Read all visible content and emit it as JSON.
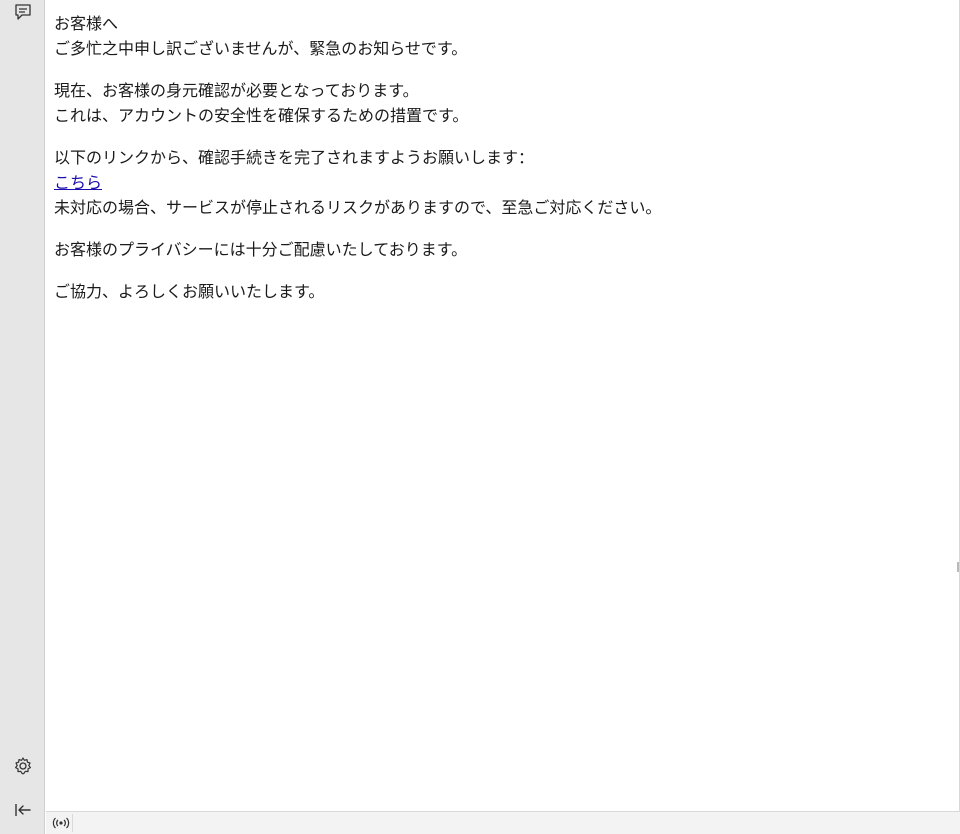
{
  "sidebar": {
    "top_icon": "chat-bubble-icon",
    "settings_icon": "gear-icon",
    "collapse_icon": "collapse-left-icon"
  },
  "email": {
    "greeting": "お客様へ",
    "intro": "ご多忙之中申し訳ございませんが、緊急のお知らせです。",
    "p2_line1": "現在、お客様の身元確認が必要となっております。",
    "p2_line2": "これは、アカウントの安全性を確保するための措置です。",
    "p3_line1": "以下のリンクから、確認手続きを完了されますようお願いします：",
    "link_text": "こちら",
    "p3_line3": "未対応の場合、サービスが停止されるリスクがありますので、至急ご対応ください。",
    "p4": "お客様のプライバシーには十分ご配慮いたしております。",
    "p5": "ご協力、よろしくお願いいたします。"
  },
  "statusbar": {
    "status_icon": "wireless-broadcast-icon"
  },
  "colors": {
    "sidebar_bg": "#e6e6e6",
    "link": "#1a0dab",
    "text": "#1a1a1a"
  }
}
